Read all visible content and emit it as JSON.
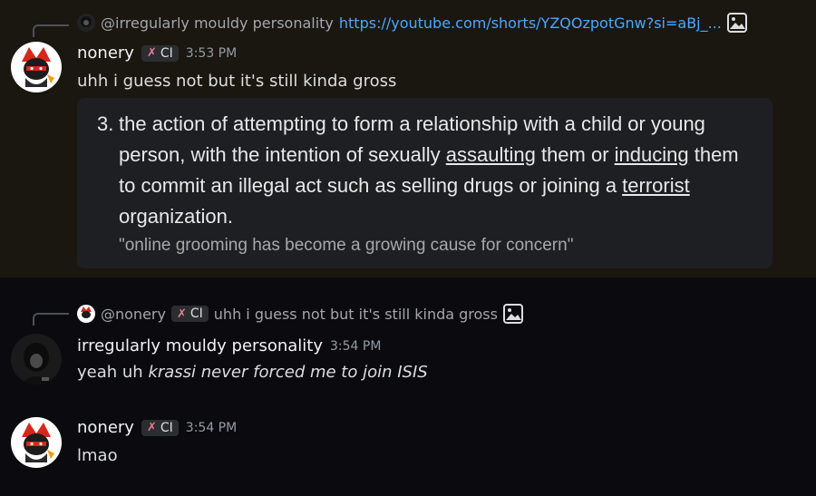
{
  "messages": [
    {
      "reply": {
        "author": "@irregularly mouldy personality",
        "link": "https://youtube.com/shorts/YZQOzpotGnw?si=aBj_...",
        "icon": "image-icon"
      },
      "author": "nonery",
      "tag": {
        "icon": "sword-icon",
        "label": "CI"
      },
      "time": "3:53 PM",
      "text": "uhh i guess not but it's still kinda gross",
      "embed": {
        "number": "3.",
        "definition": {
          "p1": "the action of attempting to form a relationship with a child or young person, with the intention of sexually ",
          "w1": "assaulting",
          "p2": " them or ",
          "w2": "inducing",
          "p3": " them to commit an illegal act such as selling drugs or joining a ",
          "w3": "terrorist",
          "p4": " organization."
        },
        "example": "\"online grooming has become a growing cause for concern\""
      }
    },
    {
      "reply": {
        "author": "@nonery",
        "tag": {
          "icon": "sword-icon",
          "label": "CI"
        },
        "text": "uhh i guess not but it's still kinda gross",
        "icon": "image-icon"
      },
      "author": "irregularly mouldy personality",
      "time": "3:54 PM",
      "text_plain": "yeah uh ",
      "text_italic": "krassi never forced me to join ISIS"
    },
    {
      "author": "nonery",
      "tag": {
        "icon": "sword-icon",
        "label": "CI"
      },
      "time": "3:54 PM",
      "text": "lmao"
    }
  ]
}
